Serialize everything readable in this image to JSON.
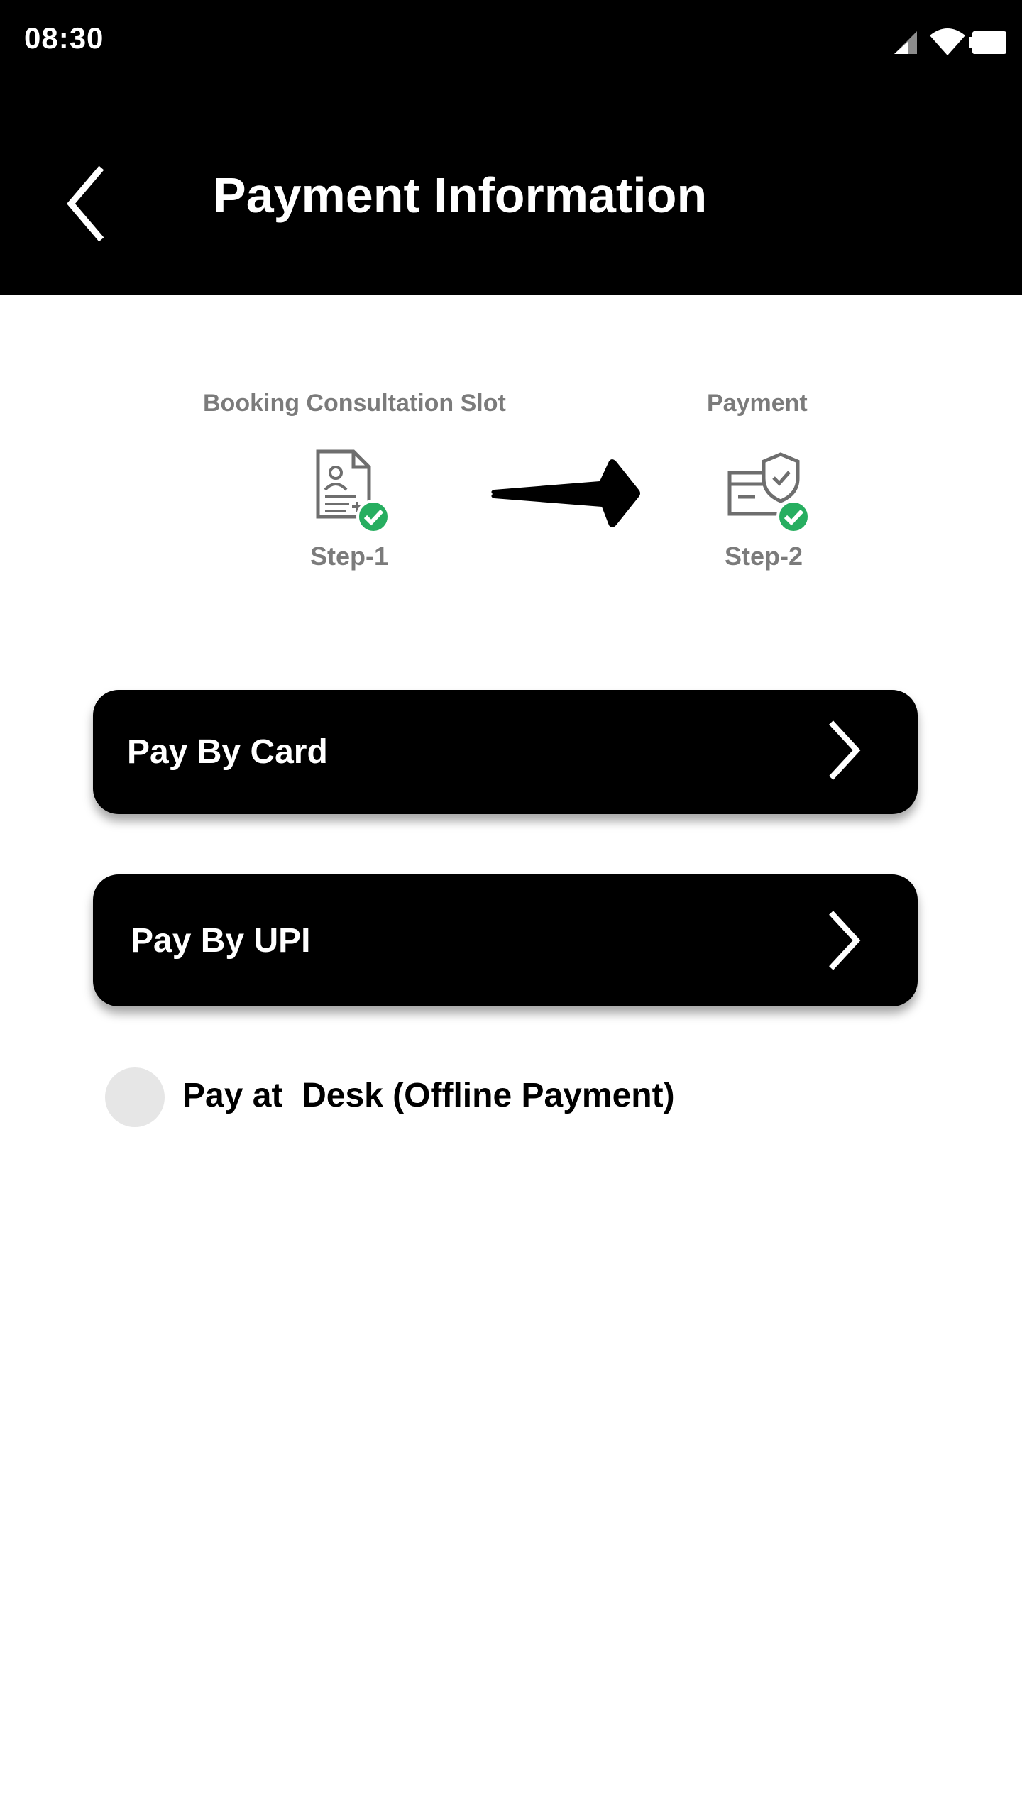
{
  "status_bar": {
    "time": "08:30",
    "icons": [
      "signal-icon",
      "wifi-icon",
      "battery-icon"
    ]
  },
  "header": {
    "title": "Payment Information",
    "back_icon": "chevron-left-icon"
  },
  "steps": [
    {
      "title": "Booking Consultation Slot",
      "caption": "Step-1",
      "icon": "document-check-icon",
      "completed": true
    },
    {
      "title": "Payment",
      "caption": "Step-2",
      "icon": "secure-card-check-icon",
      "completed": true
    }
  ],
  "payment_options": {
    "card_label": "Pay By Card",
    "upi_label": "Pay By UPI",
    "offline_label": "Pay at  Desk (Offline Payment)",
    "offline_selected": false
  },
  "colors": {
    "header_bg": "#000000",
    "step_text": "#7b7b7b",
    "check_green": "#27ae60",
    "button_bg": "#000000",
    "radio_bg": "#e6e6e6"
  }
}
